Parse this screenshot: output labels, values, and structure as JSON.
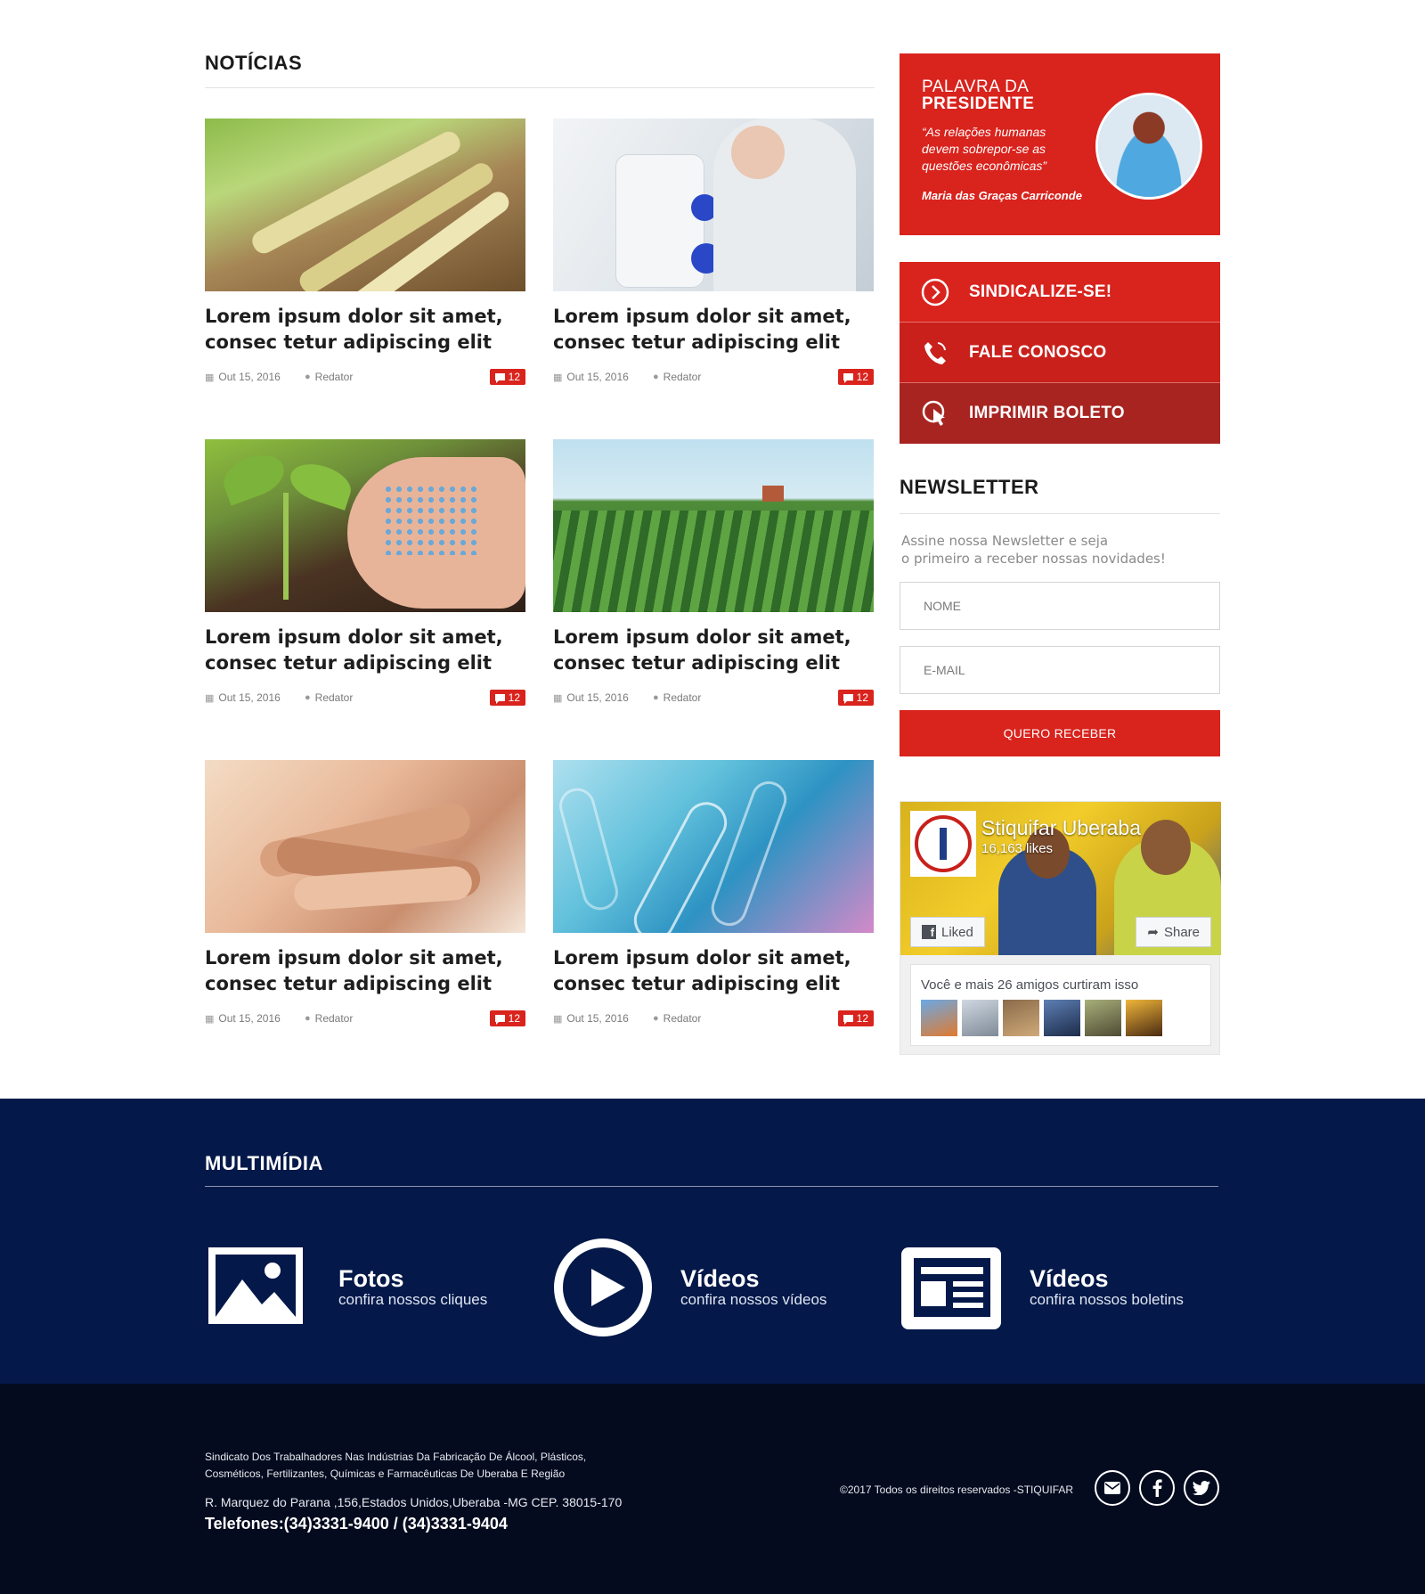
{
  "news": {
    "title": "NOTÍCIAS",
    "items": [
      {
        "title": "Lorem ipsum dolor sit amet, consec tetur adipiscing elit",
        "date": "Out 15, 2016",
        "author": "Redator",
        "comments": "12",
        "image": "sugarcane"
      },
      {
        "title": "Lorem ipsum dolor sit amet, consec tetur adipiscing elit",
        "date": "Out 15, 2016",
        "author": "Redator",
        "comments": "12",
        "image": "lab-microscope"
      },
      {
        "title": "Lorem ipsum dolor sit amet, consec tetur adipiscing elit",
        "date": "Out 15, 2016",
        "author": "Redator",
        "comments": "12",
        "image": "seedling-fertilizer"
      },
      {
        "title": "Lorem ipsum dolor sit amet, consec tetur adipiscing elit",
        "date": "Out 15, 2016",
        "author": "Redator",
        "comments": "12",
        "image": "crop-field"
      },
      {
        "title": "Lorem ipsum dolor sit amet, consec tetur adipiscing elit",
        "date": "Out 15, 2016",
        "author": "Redator",
        "comments": "12",
        "image": "stacked-hands"
      },
      {
        "title": "Lorem ipsum dolor sit amet, consec tetur adipiscing elit",
        "date": "Out 15, 2016",
        "author": "Redator",
        "comments": "12",
        "image": "test-tubes"
      }
    ]
  },
  "president": {
    "label_small": "PALAVRA DA",
    "label_big": "PRESIDENTE",
    "quote": "“As relações humanas devem sobrepor-se as questões econômicas”",
    "name": "Maria das Graças Carriconde"
  },
  "actions": [
    {
      "label": "SINDICALIZE-SE!",
      "icon": "chevron-circle-icon"
    },
    {
      "label": "FALE CONOSCO",
      "icon": "phone-icon"
    },
    {
      "label": "IMPRIMIR BOLETO",
      "icon": "click-icon"
    }
  ],
  "newsletter": {
    "title": "NEWSLETTER",
    "desc_line1": "Assine nossa Newsletter e seja",
    "desc_line2": "o primeiro a receber nossas novidades!",
    "name_placeholder": "NOME",
    "email_placeholder": "E-MAIL",
    "submit_label": "QUERO RECEBER"
  },
  "facebook": {
    "page_name": "Stiquifar Uberaba",
    "likes": "16,163 likes",
    "liked_label": "Liked",
    "share_label": "Share",
    "friends_text": "Você e mais 26 amigos curtiram isso"
  },
  "multimedia": {
    "title": "MULTIMÍDIA",
    "items": [
      {
        "head": "Fotos",
        "sub": "confira nossos cliques",
        "icon": "image-icon"
      },
      {
        "head": "Vídeos",
        "sub": "confira nossos vídeos",
        "icon": "play-icon"
      },
      {
        "head": "Vídeos",
        "sub": "confira nossos boletins",
        "icon": "newspaper-icon"
      }
    ]
  },
  "footer": {
    "desc_line1": "Sindicato Dos Trabalhadores Nas Indústrias Da Fabricação De Álcool, Plásticos,",
    "desc_line2": "Cosméticos, Fertilizantes, Químicas e Farmacêuticas De Uberaba E Região",
    "address": "R. Marquez do Parana ,156,Estados Unidos,Uberaba -MG CEP. 38015-170",
    "phones": "Telefones:(34)3331-9400 / (34)3331-9404",
    "copyright": "©2017  Todos os direitos reservados -STIQUIFAR",
    "social": [
      "email-icon",
      "facebook-icon",
      "twitter-icon"
    ]
  },
  "colors": {
    "brand_red": "#d9231d",
    "navy": "#041849",
    "footer_dark": "#040b1f"
  }
}
